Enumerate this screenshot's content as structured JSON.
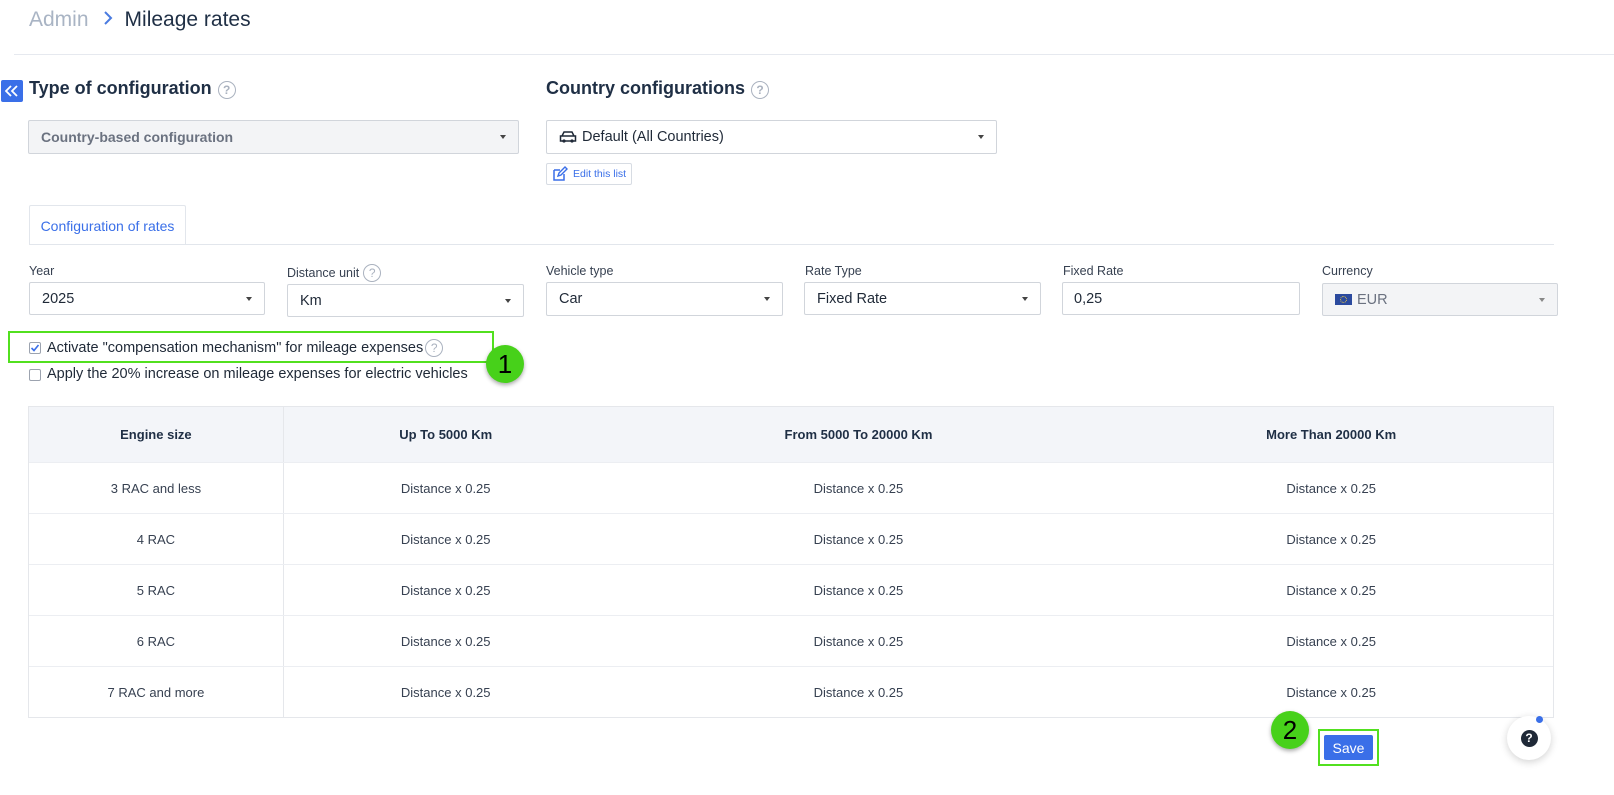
{
  "breadcrumb": {
    "root": "Admin",
    "separator": ">",
    "current": "Mileage rates"
  },
  "type_config": {
    "title": "Type of configuration",
    "help": "?",
    "select_value": "Country-based configuration"
  },
  "country_config": {
    "title": "Country configurations",
    "help": "?",
    "select_value": "Default (All Countries)",
    "edit_link": "Edit this list"
  },
  "tabs": [
    {
      "label": "Configuration of rates",
      "active": true
    }
  ],
  "fields": {
    "year": {
      "label": "Year",
      "value": "2025"
    },
    "distance_unit": {
      "label": "Distance unit",
      "help": "?",
      "value": "Km"
    },
    "vehicle_type": {
      "label": "Vehicle type",
      "value": "Car"
    },
    "rate_type": {
      "label": "Rate Type",
      "value": "Fixed Rate"
    },
    "fixed_rate": {
      "label": "Fixed Rate",
      "value": "0,25"
    },
    "currency": {
      "label": "Currency",
      "value": "EUR"
    }
  },
  "checkboxes": {
    "compensation": {
      "label": "Activate \"compensation mechanism\" for mileage expenses",
      "checked": true,
      "help": "?"
    },
    "electric": {
      "label": "Apply the 20% increase on mileage expenses for electric vehicles",
      "checked": false
    }
  },
  "annotations": {
    "marker1": "1",
    "marker2": "2",
    "highlight_color": "#52e01f"
  },
  "table": {
    "headers": [
      "Engine size",
      "Up To 5000 Km",
      "From 5000 To 20000 Km",
      "More Than 20000 Km"
    ],
    "rows": [
      [
        "3 RAC and less",
        "Distance x 0.25",
        "Distance x 0.25",
        "Distance x 0.25"
      ],
      [
        "4 RAC",
        "Distance x 0.25",
        "Distance x 0.25",
        "Distance x 0.25"
      ],
      [
        "5 RAC",
        "Distance x 0.25",
        "Distance x 0.25",
        "Distance x 0.25"
      ],
      [
        "6 RAC",
        "Distance x 0.25",
        "Distance x 0.25",
        "Distance x 0.25"
      ],
      [
        "7 RAC and more",
        "Distance x 0.25",
        "Distance x 0.25",
        "Distance x 0.25"
      ]
    ]
  },
  "actions": {
    "save_label": "Save",
    "help_fab": "?"
  },
  "colors": {
    "accent": "#3a6fe8",
    "header_bg": "#f3f5f9",
    "marker": "#47d11a"
  },
  "icons": [
    "chevrons-left-icon",
    "help-circle-icon",
    "car-icon",
    "edit-icon",
    "eu-flag-icon",
    "check-icon",
    "caret-down-icon"
  ]
}
